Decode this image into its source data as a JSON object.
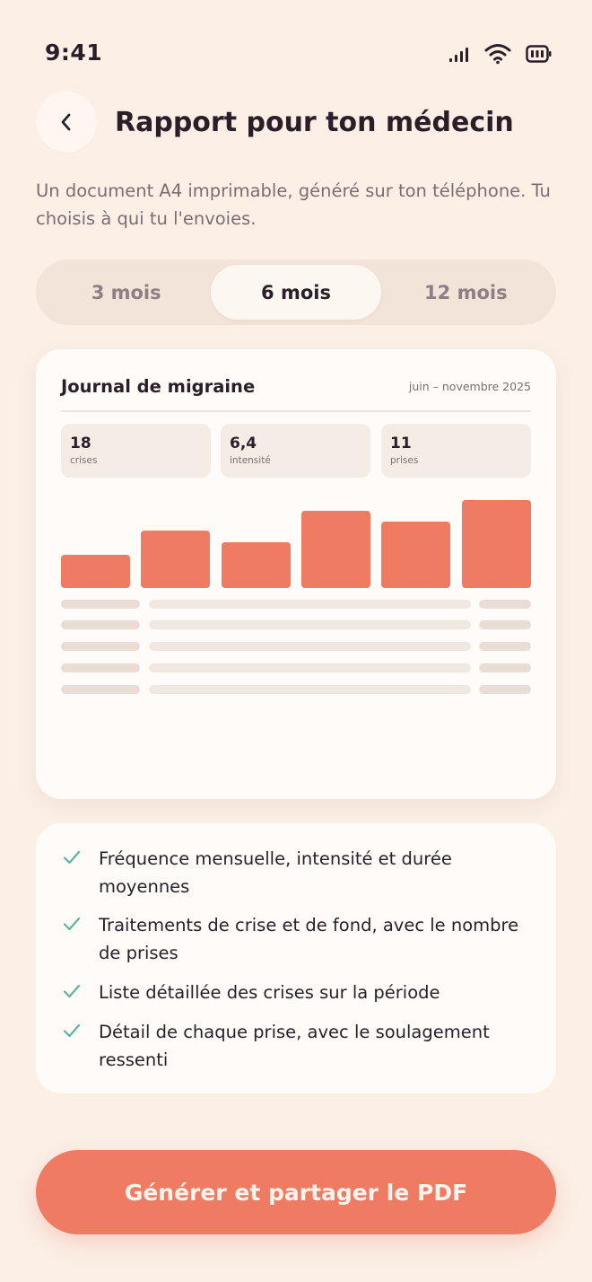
{
  "status": {
    "time": "9:41"
  },
  "header": {
    "title": "Rapport pour ton médecin"
  },
  "subtitle": "Un document A4 imprimable, généré sur ton téléphone. Tu choisis à qui tu l'envoies.",
  "periods": [
    {
      "label": "3 mois",
      "active": false
    },
    {
      "label": "6 mois",
      "active": true
    },
    {
      "label": "12 mois",
      "active": false
    }
  ],
  "report": {
    "title": "Journal de migraine",
    "period": "juin – novembre 2025",
    "stats": [
      {
        "value": "18",
        "label": "crises"
      },
      {
        "value": "6,4",
        "label": "intensité"
      },
      {
        "value": "11",
        "label": "prises"
      }
    ],
    "bar_levels": [
      0.38,
      0.65,
      0.52,
      0.88,
      0.75,
      1.0
    ]
  },
  "features": [
    "Fréquence mensuelle, intensité et durée moyennes",
    "Traitements de crise et de fond, avec le nombre de prises",
    "Liste détaillée des crises sur la période",
    "Détail de chaque prise, avec le soulagement ressenti"
  ],
  "cta_label": "Générer et partager le PDF",
  "colors": {
    "accent": "#ef7b62",
    "check": "#5ab5a0",
    "background": "#fbefe6"
  },
  "icons": {
    "back": "chevron-left-icon",
    "signal": "signal-icon",
    "wifi": "wifi-icon",
    "battery": "battery-icon",
    "check": "check-icon"
  }
}
